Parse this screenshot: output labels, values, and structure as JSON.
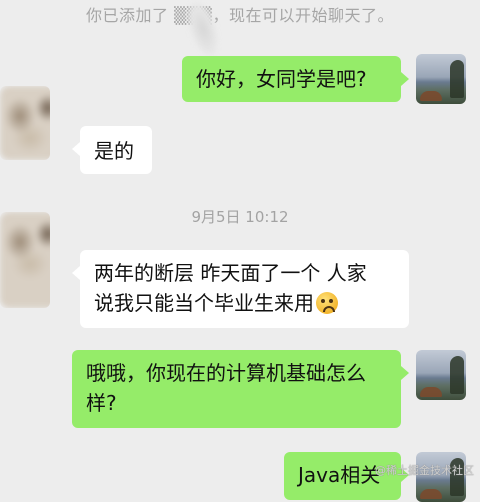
{
  "system_notice": "你已添加了 ▒▒▒，现在可以开始聊天了。",
  "time_separator": "9月5日 10:12",
  "messages": [
    {
      "side": "right",
      "text": "你好，女同学是吧?"
    },
    {
      "side": "left",
      "text": "是的"
    },
    {
      "side": "left",
      "line1": "两年的断层  昨天面了一个  人家",
      "line2": "说我只能当个毕业生来用",
      "emoji": "crying-face-emoji"
    },
    {
      "side": "right",
      "line1": "哦哦，你现在的计算机基础怎么",
      "line2": "样?"
    },
    {
      "side": "right",
      "text": "Java相关"
    }
  ],
  "watermark": "@稀土掘金技术社区",
  "colors": {
    "background": "#ededed",
    "sent_bubble": "#95ec69",
    "received_bubble": "#ffffff"
  }
}
